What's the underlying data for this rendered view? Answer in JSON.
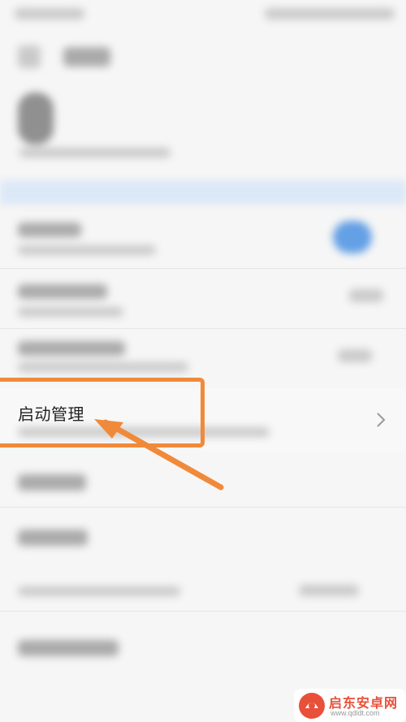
{
  "row": {
    "title": "启动管理"
  },
  "watermark": {
    "brand": "启东安卓网",
    "url": "www.qdldt.com"
  },
  "colors": {
    "highlight": "#f08a3a",
    "toggle_on": "#4a90e2",
    "watermark_red": "#e8503a"
  },
  "icons": {
    "row_chevron": "chevron-right-icon",
    "annotation_arrow": "arrow-icon"
  }
}
